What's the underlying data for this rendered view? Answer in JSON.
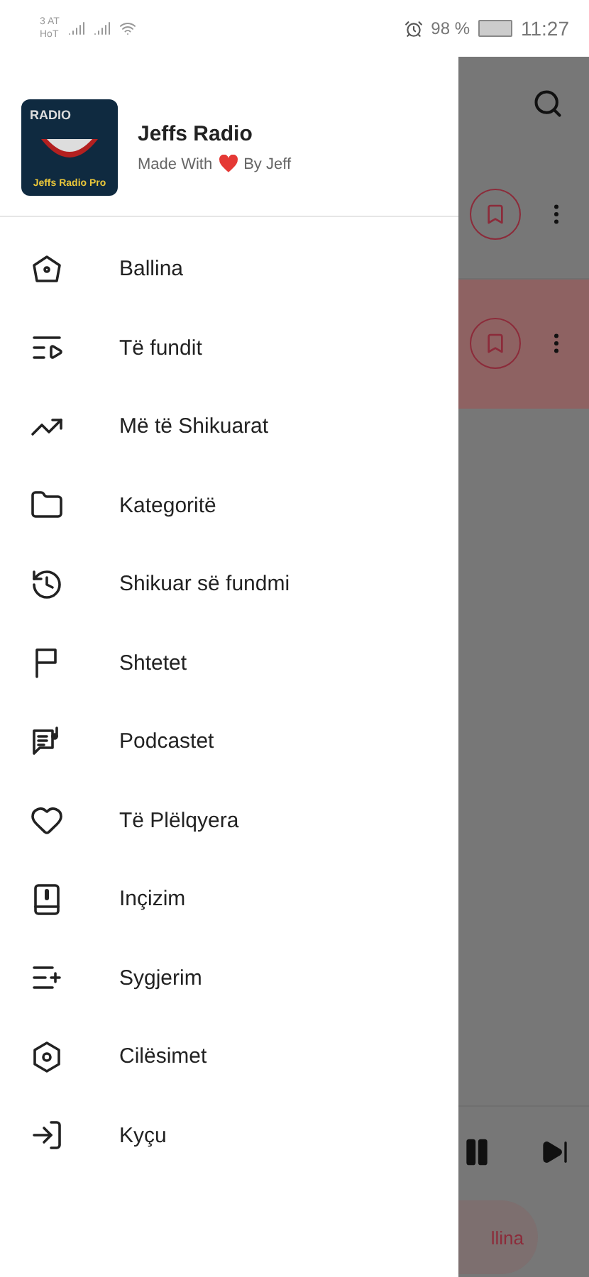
{
  "status_bar": {
    "carrier_lines": [
      "3 AT",
      "HoT"
    ],
    "battery": "98 %",
    "time": "11:27"
  },
  "drawer": {
    "logo": {
      "top_text": "RADIO",
      "bottom_text": "Jeffs Radio Pro"
    },
    "title": "Jeffs Radio",
    "subtitle_start": "Made With",
    "subtitle_end": "By Jeff",
    "items": [
      {
        "kind": "home",
        "label": "Ballina"
      },
      {
        "kind": "recent",
        "label": "Të fundit"
      },
      {
        "kind": "trending",
        "label": "Më të Shikuarat"
      },
      {
        "kind": "folder",
        "label": "Kategoritë"
      },
      {
        "kind": "history",
        "label": "Shikuar së fundmi"
      },
      {
        "kind": "flag",
        "label": "Shtetet"
      },
      {
        "kind": "podcast",
        "label": "Podcastet"
      },
      {
        "kind": "heart",
        "label": "Të Plëlqyera"
      },
      {
        "kind": "record",
        "label": "Inçizim"
      },
      {
        "kind": "add",
        "label": "Sygjerim"
      },
      {
        "kind": "settings",
        "label": "Cilësimet"
      },
      {
        "kind": "login",
        "label": "Kyçu"
      }
    ]
  },
  "background": {
    "rows": [
      {
        "selected": false
      },
      {
        "selected": true
      }
    ],
    "nav_label": "llina"
  }
}
